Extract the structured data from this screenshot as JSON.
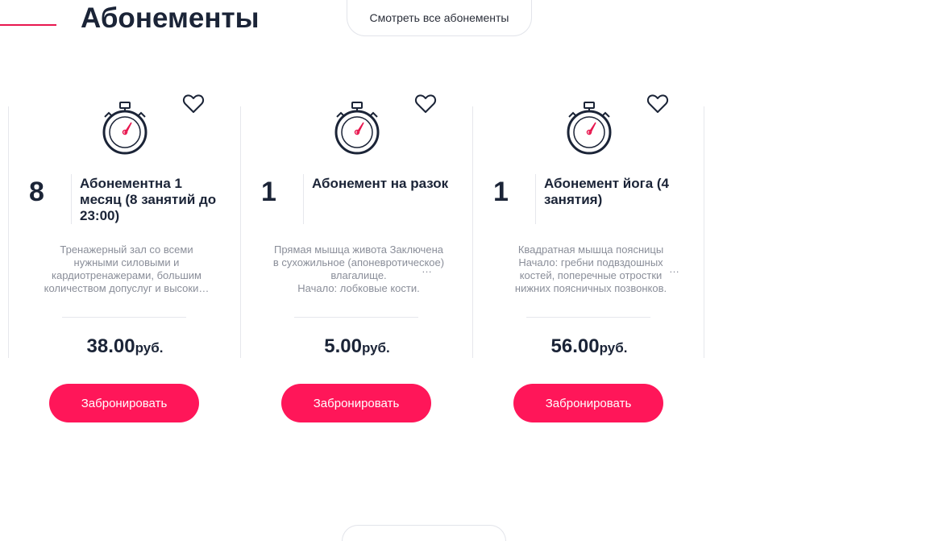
{
  "header": {
    "title": "Абонементы",
    "view_all_label": "Смотреть все абонементы"
  },
  "cards": [
    {
      "count": "8",
      "title": "Абонементна 1 месяц (8 занятий до 23:00)",
      "description": "Тренажерный зал со всеми нужными силовыми и кардиотренажерами, большим количеством допуслуг и высоки…",
      "price": "38.00",
      "currency": "руб.",
      "button_label": "Забронировать",
      "icons": [
        "heart-icon",
        "stopwatch-icon"
      ]
    },
    {
      "count": "1",
      "title": "Абонемент на разок",
      "description": "Прямая мышца живота Заключена в сухожильное (апоневротическое) влагалище.\nНачало: лобковые кости.",
      "ellipsis": "…",
      "price": "5.00",
      "currency": "руб.",
      "button_label": "Забронировать",
      "icons": [
        "heart-icon",
        "stopwatch-icon"
      ]
    },
    {
      "count": "1",
      "title": "Абонемент йога (4 занятия)",
      "description": "Квадратная мышца поясницы\nНачало: гребни подвздошных костей, поперечные отростки нижних поясничных позвонков.",
      "ellipsis": "…",
      "price": "56.00",
      "currency": "руб.",
      "button_label": "Забронировать",
      "icons": [
        "heart-icon",
        "stopwatch-icon"
      ]
    }
  ],
  "colors": {
    "accent": "#ff1659",
    "accent_line": "#e8174f",
    "text_dark": "#1b2437",
    "text_muted": "#8a8e99",
    "border": "#e6e7ec"
  }
}
